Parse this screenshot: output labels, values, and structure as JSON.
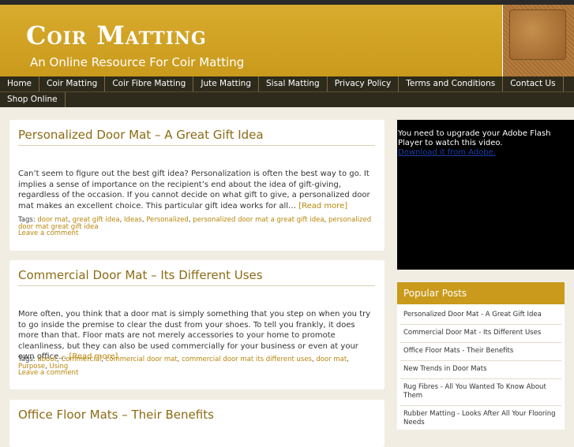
{
  "header": {
    "title": "Coir Matting",
    "tagline": "An Online Resource For Coir Matting"
  },
  "nav": {
    "row1": [
      "Home",
      "Coir Matting",
      "Coir Fibre Matting",
      "Jute Matting",
      "Sisal Matting",
      "Privacy Policy",
      "Terms and Conditions",
      "Contact Us"
    ],
    "row2": [
      "Shop Online"
    ]
  },
  "posts": [
    {
      "title": "Personalized Door Mat – A Great Gift Idea",
      "excerpt": "Can’t seem to figure out the best gift idea? Personalization is often the best way to go. It implies a sense of importance on the recipient’s end about the idea of gift-giving, regardless of the occasion. If you cannot decide on what gift to give, a personalized door mat makes an excellent choice. This particular gift idea works for all… ",
      "read_more": "[Read more]",
      "tags_label": "Tags: ",
      "tags": [
        "door mat",
        "great gift idea",
        "Ideas",
        "Personalized",
        "personalized door mat a great gift idea",
        "personalized door mat great gift idea"
      ],
      "comment": "Leave a comment"
    },
    {
      "title": "Commercial Door Mat – Its Different Uses",
      "excerpt": "More often, you think that a door mat is simply something that you step on when you try to go inside the premise to clear the dust from your shoes. To tell you frankly, it does more than that. Floor mats are not merely accessories to your home to promote cleanliness, but they can also be used commercially for your business or even at your own office… ",
      "read_more": "[Read more]",
      "tags_label": "Tags: ",
      "tags": [
        "about",
        "Commercial",
        "commercial door mat",
        "commercial door mat its different uses",
        "door mat",
        "Purpose",
        "Using"
      ],
      "comment": "Leave a comment"
    },
    {
      "title": "Office Floor Mats – Their Benefits"
    }
  ],
  "video": {
    "message": "You need to upgrade your Adobe Flash Player to watch this video.",
    "link": "Download it from Adobe."
  },
  "popular": {
    "heading": "Popular Posts",
    "items": [
      "Personalized Door Mat - A Great Gift Idea",
      "Commercial Door Mat - Its Different Uses",
      "Office Floor Mats - Their Benefits",
      "New Trends in Door Mats",
      "Rug Fibres - All You Wanted To Know About Them",
      "Rubber Matting - Looks After All Your Flooring Needs"
    ]
  }
}
